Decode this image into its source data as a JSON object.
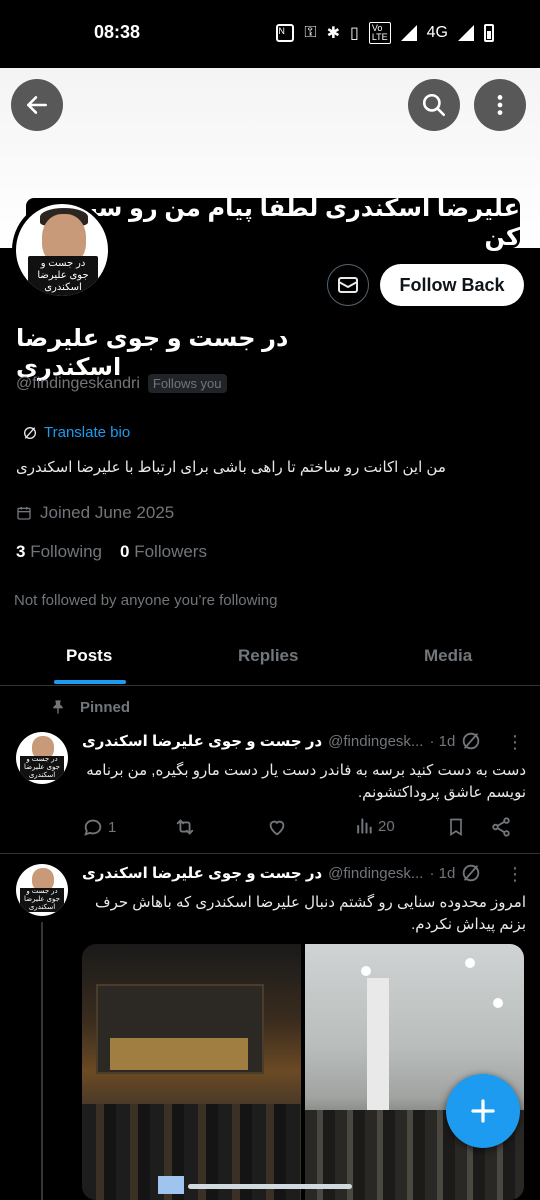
{
  "status_bar": {
    "time": "08:38",
    "network": "4G",
    "icons": [
      "nfc-icon",
      "vpn-key-icon",
      "bluetooth-icon",
      "vibrate-icon",
      "volte-icon",
      "signal-icon",
      "battery-icon"
    ]
  },
  "banner": {
    "caption": "علیرضا اسکندری لطفا پیام من رو سین کن"
  },
  "avatar": {
    "label": "در جست و جوی علیرضا اسکندری"
  },
  "profile": {
    "follow_button": "Follow Back",
    "display_name": "در جست و جوی علیرضا اسکندری",
    "handle": "@findingeskandri",
    "follows_you": "Follows you",
    "translate_bio": "Translate bio",
    "bio": "من این اکانت رو ساختم تا راهی باشی برای ارتباط با علیرضا اسکندری",
    "joined": "Joined June 2025",
    "following_count": "3",
    "following_label": "Following",
    "followers_count": "0",
    "followers_label": "Followers",
    "not_followed": "Not followed by anyone you’re following"
  },
  "tabs": [
    {
      "label": "Posts",
      "active": true
    },
    {
      "label": "Replies",
      "active": false
    },
    {
      "label": "Media",
      "active": false
    }
  ],
  "pinned_label": "Pinned",
  "posts": [
    {
      "author": "در جست و جوی علیرضا اسکندری",
      "handle": "@findingesk...",
      "time": "· 1d",
      "text": "دست به دست کنید برسه به فاندر دست یار دست مارو بگیره, من برنامه نویسم عاشق پروداکتشونم.",
      "replies": "1",
      "views": "20"
    },
    {
      "author": "در جست و جوی علیرضا اسکندری",
      "handle": "@findingesk...",
      "time": "· 1d",
      "text": "امروز محدوده سنایی رو گشتم دنبال علیرضا اسکندری که باهاش حرف بزنم پیداش نکردم."
    }
  ],
  "colors": {
    "accent": "#1d9bf0",
    "background": "#000000",
    "muted": "#71767b",
    "divider": "#2f3336"
  }
}
